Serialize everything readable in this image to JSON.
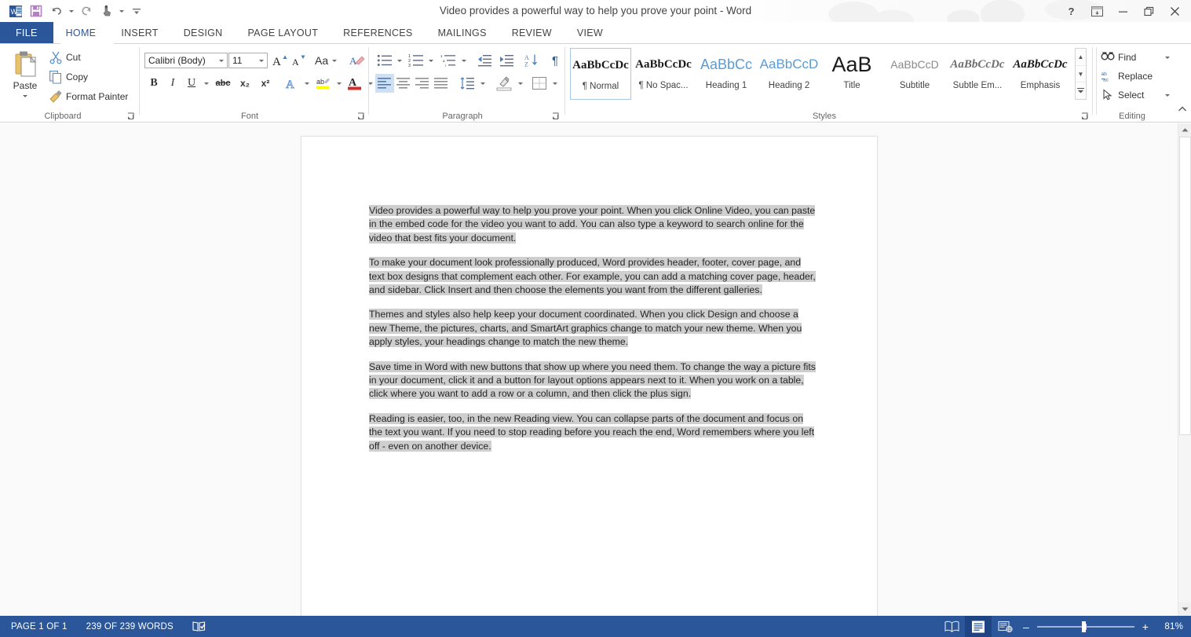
{
  "window": {
    "title": "Video provides a powerful way to help you prove your point - Word",
    "controls": {
      "help": "?",
      "ribbon_display": "ribbon-display-options",
      "minimize": "–",
      "restore": "restore",
      "close": "✕"
    }
  },
  "quick_access": {
    "items": [
      {
        "name": "word-logo-icon",
        "label": "W"
      },
      {
        "name": "save-icon",
        "label": "Save"
      },
      {
        "name": "undo-icon",
        "label": "Undo"
      },
      {
        "name": "redo-icon",
        "label": "Redo"
      },
      {
        "name": "touch-mode-icon",
        "label": "Touch/Mouse Mode"
      },
      {
        "name": "customize-qat-icon",
        "label": "Customize Quick Access Toolbar"
      }
    ]
  },
  "tabs": [
    {
      "id": "file",
      "label": "FILE"
    },
    {
      "id": "home",
      "label": "HOME"
    },
    {
      "id": "insert",
      "label": "INSERT"
    },
    {
      "id": "design",
      "label": "DESIGN"
    },
    {
      "id": "pagelayout",
      "label": "PAGE LAYOUT"
    },
    {
      "id": "references",
      "label": "REFERENCES"
    },
    {
      "id": "mailings",
      "label": "MAILINGS"
    },
    {
      "id": "review",
      "label": "REVIEW"
    },
    {
      "id": "view",
      "label": "VIEW"
    }
  ],
  "active_tab": "HOME",
  "ribbon": {
    "clipboard": {
      "group_label": "Clipboard",
      "paste_label": "Paste",
      "cut_label": "Cut",
      "copy_label": "Copy",
      "format_painter_label": "Format Painter"
    },
    "font": {
      "group_label": "Font",
      "font_name": "Calibri (Body)",
      "font_size": "11",
      "grow_font": "A",
      "shrink_font": "A",
      "change_case": "Aa",
      "clear_formatting": "Clear All Formatting",
      "bold": "B",
      "italic": "I",
      "underline": "U",
      "strikethrough": "abc",
      "subscript": "x₂",
      "superscript": "x²",
      "text_effects": "A",
      "highlight": "ab",
      "font_color": "A"
    },
    "paragraph": {
      "group_label": "Paragraph",
      "bullets": "Bullets",
      "numbering": "Numbering",
      "multilevel": "Multilevel List",
      "decrease_indent": "Decrease Indent",
      "increase_indent": "Increase Indent",
      "sort": "Sort",
      "show_marks": "¶",
      "align_left": "Align Left",
      "align_center": "Center",
      "align_right": "Align Right",
      "justify": "Justify",
      "line_spacing": "Line and Paragraph Spacing",
      "shading": "Shading",
      "borders": "Borders"
    },
    "styles": {
      "group_label": "Styles",
      "items": [
        {
          "preview": "AaBbCcDc",
          "name": "¶ Normal",
          "selected": true
        },
        {
          "preview": "AaBbCcDc",
          "name": "¶ No Spac...",
          "selected": false
        },
        {
          "preview": "AaBbCс",
          "name": "Heading 1",
          "selected": false
        },
        {
          "preview": "AaBbCcD",
          "name": "Heading 2",
          "selected": false
        },
        {
          "preview": "AaB",
          "name": "Title",
          "selected": false
        },
        {
          "preview": "AaBbCcD",
          "name": "Subtitle",
          "selected": false
        },
        {
          "preview": "AaBbCcDc",
          "name": "Subtle Em...",
          "selected": false
        },
        {
          "preview": "AaBbCcDc",
          "name": "Emphasis",
          "selected": false
        }
      ],
      "scroll_up": "▲",
      "scroll_down": "▼",
      "more": "≡"
    },
    "editing": {
      "group_label": "Editing",
      "find_label": "Find",
      "replace_label": "Replace",
      "select_label": "Select"
    },
    "collapse_ribbon": "^"
  },
  "document": {
    "paragraphs": [
      "Video provides a powerful way to help you prove your point. When you click Online Video, you can paste in the embed code for the video you want to add. You can also type a keyword to search online for the video that best fits your document.",
      "To make your document look professionally produced, Word provides header, footer, cover page, and text box designs that complement each other. For example, you can add a matching cover page, header, and sidebar. Click Insert and then choose the elements you want from the different galleries.",
      "Themes and styles also help keep your document coordinated. When you click Design and choose a new Theme, the pictures, charts, and SmartArt graphics change to match your new theme. When you apply styles, your headings change to match the new theme.",
      "Save time in Word with new buttons that show up where you need them. To change the way a picture fits in your document, click it and a button for layout options appears next to it. When you work on a table, click where you want to add a row or a column, and then click the plus sign.",
      "Reading is easier, too, in the new Reading view. You can collapse parts of the document and focus on the text you want. If you need to stop reading before you reach the end, Word remembers where you left off - even on another device."
    ],
    "selection_color": "#cfcfcf",
    "all_selected": true
  },
  "status_bar": {
    "page_info": "PAGE 1 OF 1",
    "word_count": "239 OF 239 WORDS",
    "proofing_icon": "proofing-errors-icon",
    "views": [
      {
        "name": "read-mode-view",
        "label": "Read Mode",
        "active": false
      },
      {
        "name": "print-layout-view",
        "label": "Print Layout",
        "active": true
      },
      {
        "name": "web-layout-view",
        "label": "Web Layout",
        "active": false
      }
    ],
    "zoom_out": "–",
    "zoom_in": "+",
    "zoom_level": "81%"
  },
  "colors": {
    "office_blue": "#2b579a",
    "tab_active_text": "#2b579a",
    "status_bg": "#2b579a",
    "selection_gray": "#cfcfcf",
    "ribbon_bg": "#ffffff",
    "canvas_bg": "#fafafa"
  }
}
